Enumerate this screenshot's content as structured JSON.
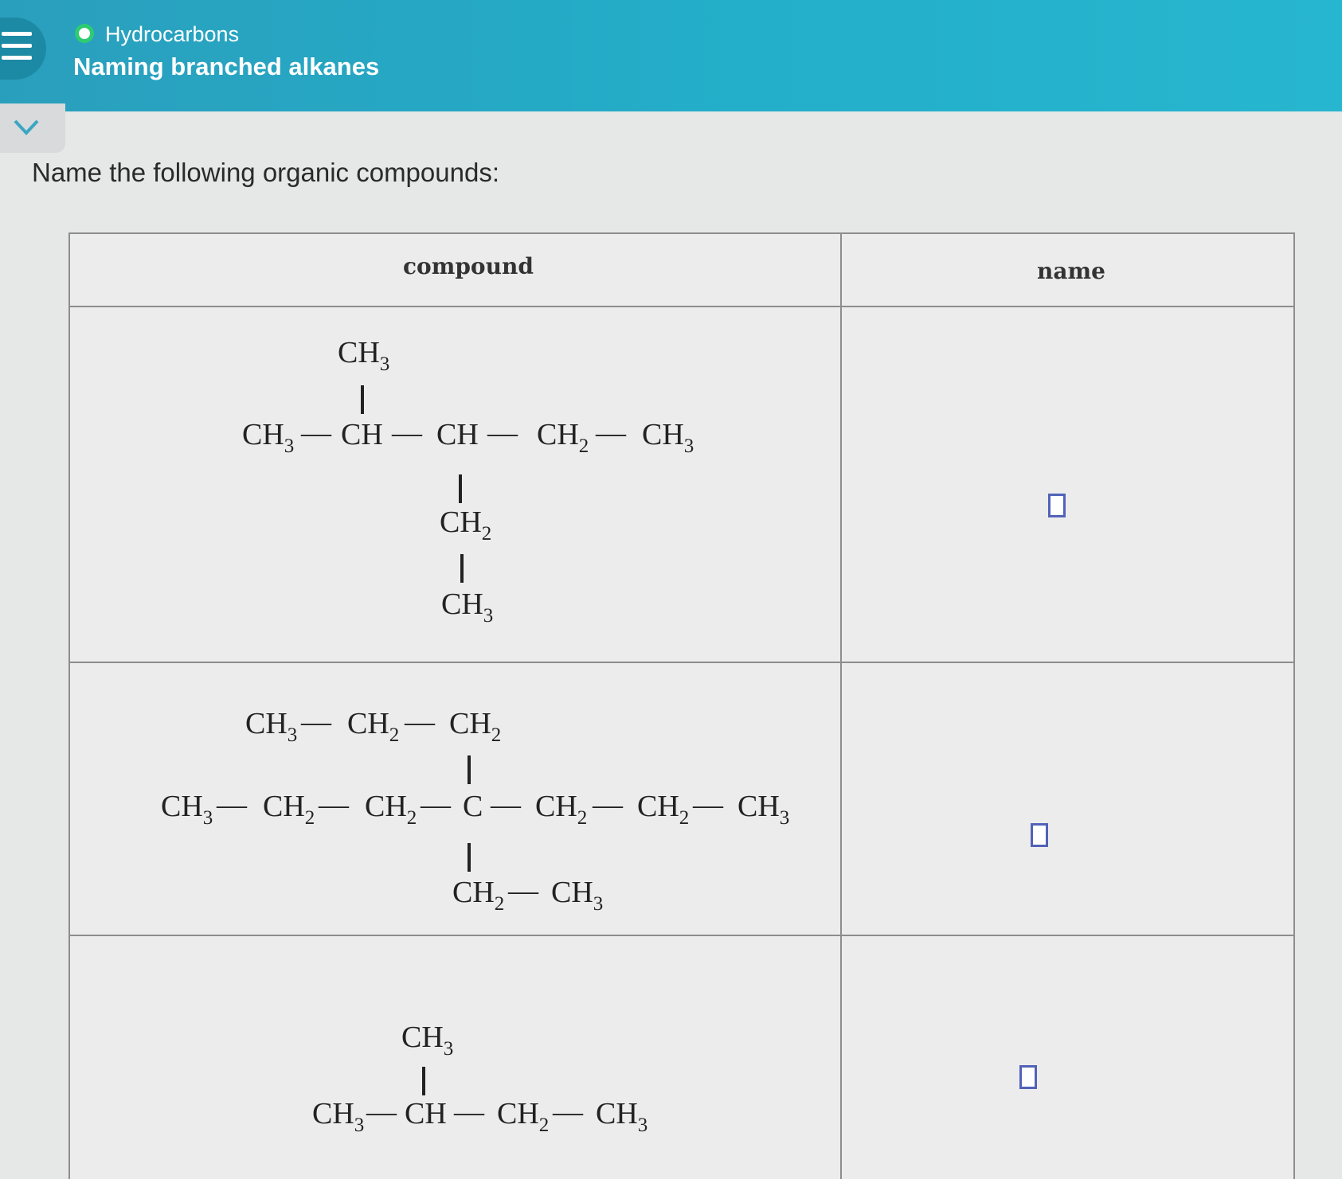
{
  "header": {
    "topic": "Hydrocarbons",
    "subtopic": "Naming branched alkanes"
  },
  "icons": {
    "menu": "hamburger-menu-icon",
    "status": "status-circle-icon",
    "collapse": "chevron-down-icon"
  },
  "colors": {
    "header_bg": "#27b0ca",
    "status_green": "#2ecc71",
    "answer_box_border": "#5262b8"
  },
  "instructions": "Name the following organic compounds:",
  "table": {
    "headers": {
      "compound": "compound",
      "name": "name"
    },
    "rows": [
      {
        "structure": {
          "top": [
            "CH",
            "3"
          ],
          "main": [
            [
              "CH",
              "3"
            ],
            [
              "CH",
              ""
            ],
            [
              "CH",
              ""
            ],
            [
              "CH",
              "2"
            ],
            [
              "CH",
              "3"
            ]
          ],
          "bottom": [
            [
              "CH",
              "2"
            ],
            [
              "CH",
              "3"
            ]
          ]
        },
        "answer": ""
      },
      {
        "structure": {
          "top": [
            [
              "CH",
              "3"
            ],
            [
              "CH",
              "2"
            ],
            [
              "CH",
              "2"
            ]
          ],
          "main": [
            [
              "CH",
              "3"
            ],
            [
              "CH",
              "2"
            ],
            [
              "CH",
              "2"
            ],
            [
              "C",
              ""
            ],
            [
              "CH",
              "2"
            ],
            [
              "CH",
              "2"
            ],
            [
              "CH",
              "3"
            ]
          ],
          "bottom": [
            [
              "CH",
              "2"
            ],
            [
              "CH",
              "3"
            ]
          ]
        },
        "answer": ""
      },
      {
        "structure": {
          "top": [
            "CH",
            "3"
          ],
          "main": [
            [
              "CH",
              "3"
            ],
            [
              "CH",
              ""
            ],
            [
              "CH",
              "2"
            ],
            [
              "CH",
              "3"
            ]
          ]
        },
        "answer": ""
      }
    ]
  }
}
